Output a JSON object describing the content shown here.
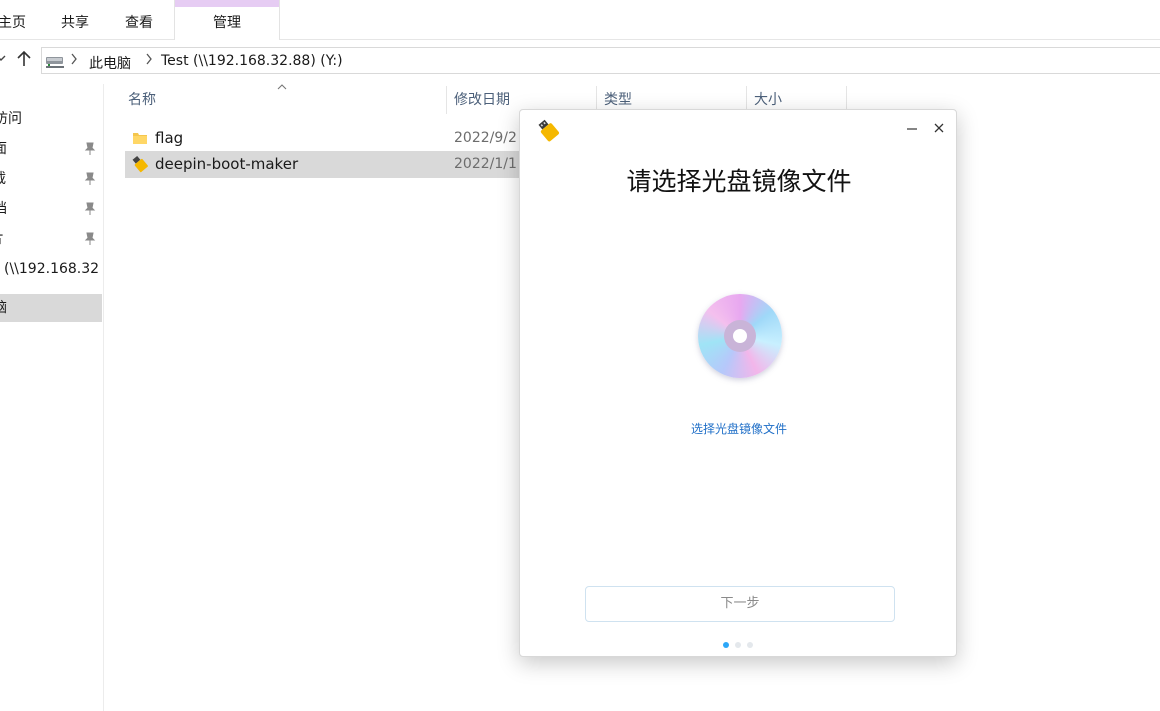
{
  "ribbon": {
    "tabs": [
      {
        "label": "主页"
      },
      {
        "label": "共享"
      },
      {
        "label": "查看"
      },
      {
        "label": "管理"
      }
    ]
  },
  "address_bar": {
    "back_icon": "chevron-down-icon",
    "up_icon": "arrow-up-icon",
    "drive_icon": "network-drive-icon",
    "segments": [
      "此电脑",
      "Test (\\\\192.168.32.88) (Y:)"
    ],
    "separator_icon": "chevron-right-icon"
  },
  "navigation_pane": {
    "items": [
      {
        "label": "访问",
        "pinned": false
      },
      {
        "label": "面",
        "pinned": true
      },
      {
        "label": "载",
        "pinned": true
      },
      {
        "label": "档",
        "pinned": true
      },
      {
        "label": "片",
        "pinned": true
      },
      {
        "label": "(\\\\192.168.32",
        "pinned": false
      },
      {
        "label": "脑",
        "pinned": false,
        "selected": true
      }
    ],
    "pin_icon": "pin-icon"
  },
  "file_list": {
    "columns": [
      "名称",
      "修改日期",
      "类型",
      "大小"
    ],
    "sort_icon": "sort-up-icon",
    "rows": [
      {
        "name": "flag",
        "date": "2022/9/2",
        "icon": "folder-icon",
        "selected": false
      },
      {
        "name": "deepin-boot-maker",
        "date": "2022/1/1",
        "icon": "usb-drive-icon",
        "selected": true
      }
    ]
  },
  "dialog": {
    "app_icon": "usb-drive-icon",
    "minimize_icon": "minimize-icon",
    "close_icon": "close-icon",
    "title": "请选择光盘镜像文件",
    "disc_icon": "disc-icon",
    "select_link": "选择光盘镜像文件",
    "next_button": "下一步",
    "step_dots": {
      "count": 3,
      "active_index": 0
    },
    "colors": {
      "accent": "#2ca7f8",
      "link": "#2170c8"
    }
  }
}
